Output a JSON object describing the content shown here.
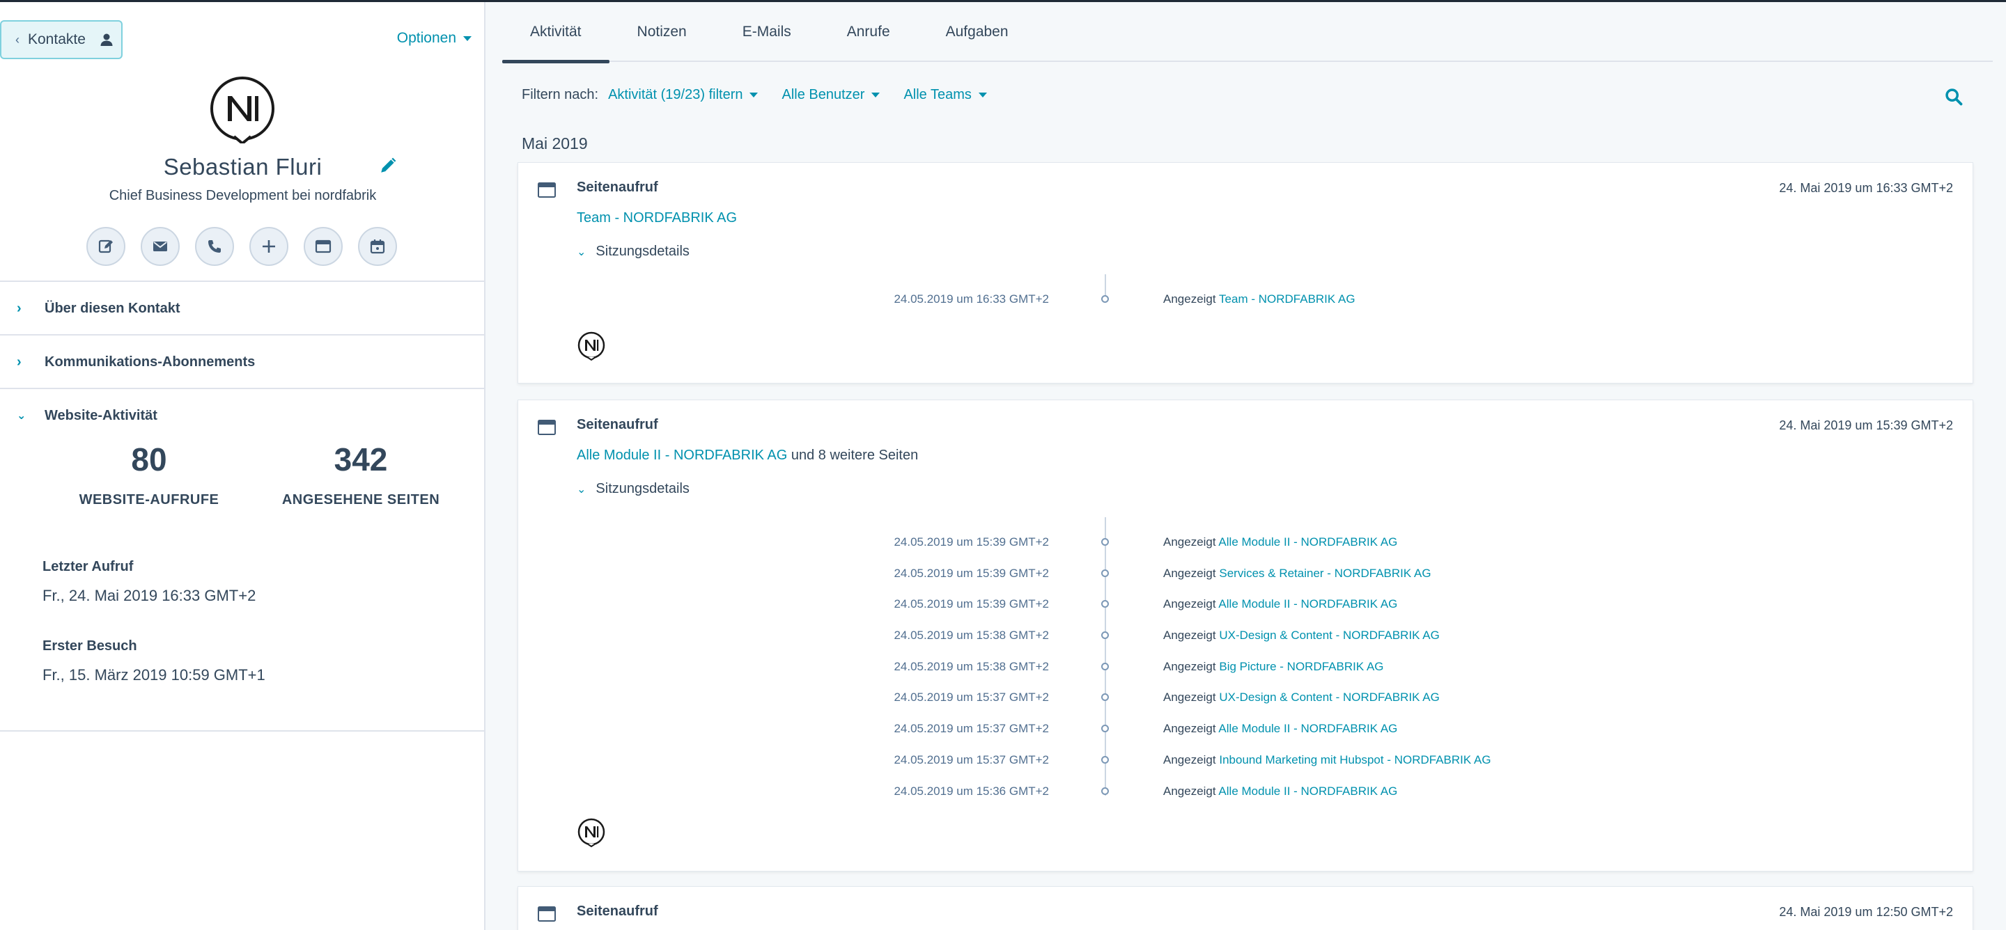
{
  "sidebar": {
    "back_label": "Kontakte",
    "options_label": "Optionen",
    "contact_name": "Sebastian Fluri",
    "contact_title": "Chief Business Development bei nordfabrik",
    "actions": [
      "note-icon",
      "email-icon",
      "call-icon",
      "add-icon",
      "browser-icon",
      "meeting-icon"
    ],
    "sections": [
      {
        "label": "Über diesen Kontakt",
        "expanded": false
      },
      {
        "label": "Kommunikations-Abonnements",
        "expanded": false
      },
      {
        "label": "Website-Aktivität",
        "expanded": true
      }
    ],
    "stats": [
      {
        "value": "80",
        "label": "WEBSITE-AUFRUFE"
      },
      {
        "value": "342",
        "label": "ANGESEHENE SEITEN"
      }
    ],
    "last_visit_label": "Letzter Aufruf",
    "last_visit_value": "Fr., 24. Mai 2019 16:33 GMT+2",
    "first_visit_label": "Erster Besuch",
    "first_visit_value": "Fr., 15. März 2019 10:59 GMT+1"
  },
  "tabs": [
    "Aktivität",
    "Notizen",
    "E-Mails",
    "Anrufe",
    "Aufgaben"
  ],
  "active_tab": "Aktivität",
  "filters": {
    "label": "Filtern nach:",
    "activity": "Aktivität (19/23) filtern",
    "users": "Alle Benutzer",
    "teams": "Alle Teams"
  },
  "month": "Mai 2019",
  "cards": [
    {
      "type": "Seitenaufruf",
      "date": "24. Mai 2019 um 16:33 GMT+2",
      "link": "Team - NORDFABRIK AG",
      "link_suffix": "",
      "session_label": "Sitzungsdetails",
      "events": [
        {
          "time": "24.05.2019 um 16:33 GMT+2",
          "prefix": "Angezeigt",
          "page": "Team - NORDFABRIK AG"
        }
      ]
    },
    {
      "type": "Seitenaufruf",
      "date": "24. Mai 2019 um 15:39 GMT+2",
      "link": "Alle Module II - NORDFABRIK AG",
      "link_suffix": " und 8 weitere Seiten",
      "session_label": "Sitzungsdetails",
      "events": [
        {
          "time": "24.05.2019 um 15:39 GMT+2",
          "prefix": "Angezeigt",
          "page": "Alle Module II - NORDFABRIK AG"
        },
        {
          "time": "24.05.2019 um 15:39 GMT+2",
          "prefix": "Angezeigt",
          "page": "Services & Retainer - NORDFABRIK AG"
        },
        {
          "time": "24.05.2019 um 15:39 GMT+2",
          "prefix": "Angezeigt",
          "page": "Alle Module II - NORDFABRIK AG"
        },
        {
          "time": "24.05.2019 um 15:38 GMT+2",
          "prefix": "Angezeigt",
          "page": "UX-Design & Content - NORDFABRIK AG"
        },
        {
          "time": "24.05.2019 um 15:38 GMT+2",
          "prefix": "Angezeigt",
          "page": "Big Picture - NORDFABRIK AG"
        },
        {
          "time": "24.05.2019 um 15:37 GMT+2",
          "prefix": "Angezeigt",
          "page": "UX-Design & Content - NORDFABRIK AG"
        },
        {
          "time": "24.05.2019 um 15:37 GMT+2",
          "prefix": "Angezeigt",
          "page": "Alle Module II - NORDFABRIK AG"
        },
        {
          "time": "24.05.2019 um 15:37 GMT+2",
          "prefix": "Angezeigt",
          "page": "Inbound Marketing mit Hubspot - NORDFABRIK AG"
        },
        {
          "time": "24.05.2019 um 15:36 GMT+2",
          "prefix": "Angezeigt",
          "page": "Alle Module II - NORDFABRIK AG"
        }
      ]
    },
    {
      "type": "Seitenaufruf",
      "date": "24. Mai 2019 um 12:50 GMT+2"
    }
  ],
  "colors": {
    "accent": "#0091ae",
    "text": "#33475b",
    "border": "#dfe3eb",
    "background": "#f5f8fa"
  }
}
